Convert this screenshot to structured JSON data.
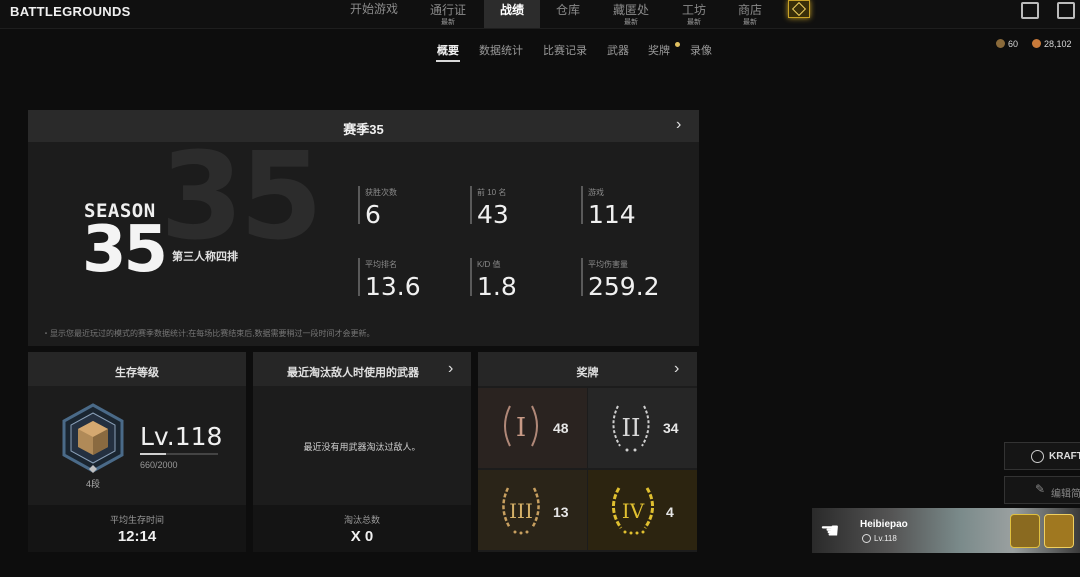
{
  "app": {
    "logo": "BATTLEGROUNDS"
  },
  "nav": {
    "items": [
      {
        "label": "开始游戏",
        "badge": ""
      },
      {
        "label": "通行证",
        "badge": "最新"
      },
      {
        "label": "战绩",
        "badge": ""
      },
      {
        "label": "仓库",
        "badge": ""
      },
      {
        "label": "藏匿处",
        "badge": "最新"
      },
      {
        "label": "工坊",
        "badge": "最新"
      },
      {
        "label": "商店",
        "badge": "最新"
      }
    ],
    "active_index": 2
  },
  "subtabs": [
    "概要",
    "数据统计",
    "比赛记录",
    "武器",
    "奖牌",
    "录像"
  ],
  "currency": {
    "a": "60",
    "b": "28,102"
  },
  "season": {
    "title": "赛季35",
    "bg_number": "35",
    "badge_word": "SEASON",
    "badge_number": "35",
    "mode": "第三人称四排",
    "stats": [
      {
        "label": "获胜次数",
        "value": "6"
      },
      {
        "label": "前 10 名",
        "value": "43"
      },
      {
        "label": "游戏",
        "value": "114"
      },
      {
        "label": "平均排名",
        "value": "13.6"
      },
      {
        "label": "K/D 值",
        "value": "1.8"
      },
      {
        "label": "平均伤害量",
        "value": "259.2"
      }
    ],
    "note": "・显示您最近玩过的模式的赛季数据统计;在每场比赛结束后,数据需要稍过一段时间才会更新。"
  },
  "survival": {
    "title": "生存等级",
    "level": "Lv.118",
    "xp": "660/2000",
    "xp_progress": 0.33,
    "tier": "4段",
    "foot_label": "平均生存时间",
    "foot_value": "12:14"
  },
  "weapon": {
    "title": "最近淘汰敌人时使用的武器",
    "empty": "最近没有用武器淘汰过敌人。",
    "foot_label": "淘汰总数",
    "foot_value": "X 0"
  },
  "medals": {
    "title": "奖牌",
    "items": [
      {
        "numeral": "I",
        "count": "48",
        "color": "#c89a86"
      },
      {
        "numeral": "II",
        "count": "34",
        "color": "#d8d8d8"
      },
      {
        "numeral": "III",
        "count": "13",
        "color": "#d4b068"
      },
      {
        "numeral": "IV",
        "count": "4",
        "color": "#e0c030"
      }
    ]
  },
  "side": {
    "krafton": "KRAFTO",
    "edit": "编辑简"
  },
  "profile": {
    "name": "Heibiepao",
    "level": "Lv.118"
  }
}
